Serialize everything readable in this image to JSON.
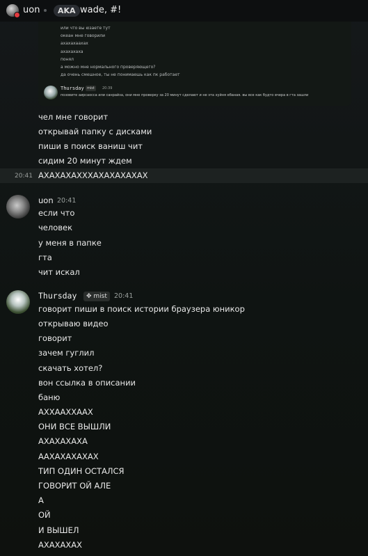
{
  "header": {
    "username": "uon",
    "aka_label": "AKA",
    "aka_name": "wade, #!"
  },
  "embed": {
    "lines": [
      "или что вы юзаете тут",
      "океан мне говорили",
      "ахахахаахах",
      "ахахахаха",
      "понял",
      "а можно мне нормального проверяющего?",
      "да очень смешное, ты не понимаешь как пк работает"
    ],
    "reply_author": "Thursday",
    "reply_tag": "mist",
    "reply_time": "20:39",
    "reply_text": "позовите аирсаосса или санрайза, они мне проверку за 20 минут сделают и не эта хуйня ебаная. вы все как будто вчера в гта зашли"
  },
  "top_messages": [
    "чел мне говорит",
    "открывай папку с дисками",
    "пиши в поиск ваниш чит",
    "сидим 20 минут ждем",
    "АХАХАХАХХХАХАХАХАХАХ"
  ],
  "highlight_time": "20:41",
  "uon_group": {
    "name": "uon",
    "time": "20:41",
    "messages": [
      "если что",
      "человек",
      "у меня в папке",
      "гта",
      "чит искал"
    ]
  },
  "thursday_group": {
    "name": "Thursday",
    "badge": "mist",
    "time": "20:41",
    "messages": [
      "говорит пиши в поиск истории браузера юникор",
      "открываю видео",
      "говорит",
      "зачем гуглил",
      "скачать хотел?",
      "вон ссылка в описании",
      "баню",
      "АХХААХХААХ",
      "ОНИ ВСЕ ВЫШЛИ",
      "АХАХАХАХА",
      "ААХАХАХАХАХ",
      "ТИП ОДИН ОСТАЛСЯ",
      "ГОВОРИТ ОЙ АЛЕ",
      "А",
      "ОЙ",
      "И ВЫШЕЛ",
      "АХАХАХАХ"
    ]
  }
}
